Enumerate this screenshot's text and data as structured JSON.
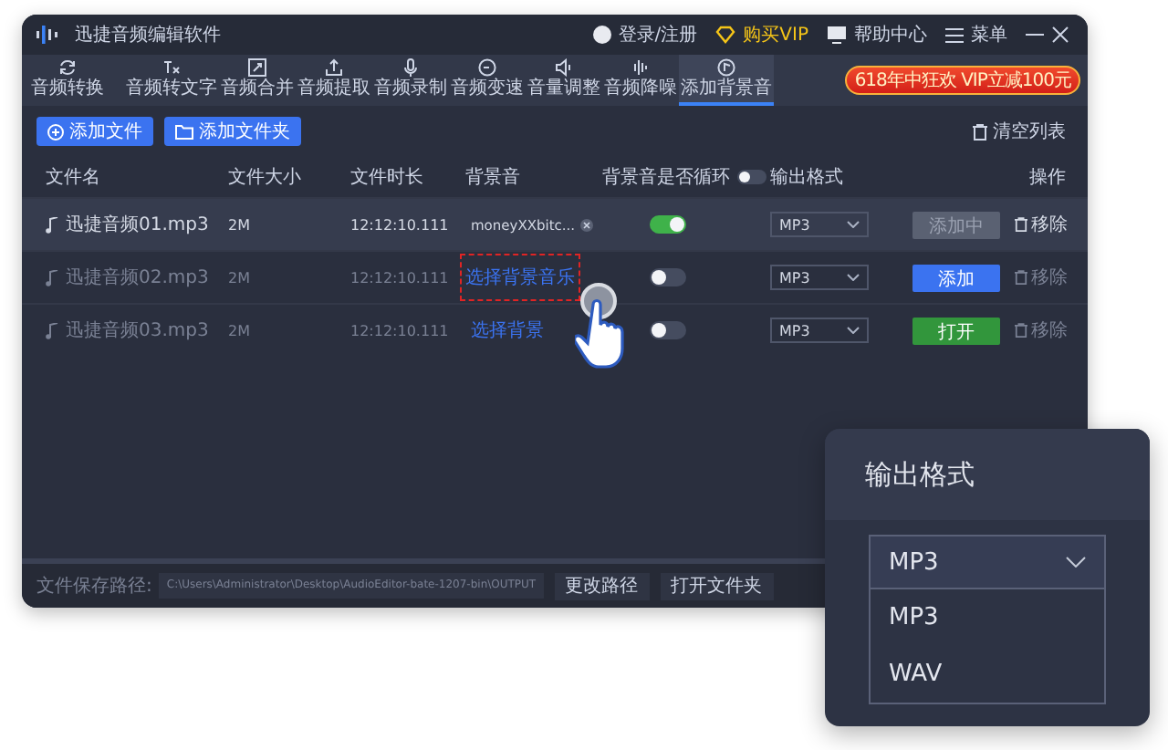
{
  "window": {
    "title": "迅捷音频编辑软件"
  },
  "title_bar": {
    "login": "登录/注册",
    "vip": "购买VIP",
    "help": "帮助中心",
    "menu": "菜单"
  },
  "tabs": [
    {
      "label": "音频转换",
      "selected": false
    },
    {
      "label": "音频转文字",
      "selected": false
    },
    {
      "label": "音频合并",
      "selected": false
    },
    {
      "label": "音频提取",
      "selected": false
    },
    {
      "label": "音频录制",
      "selected": false
    },
    {
      "label": "音频变速",
      "selected": false
    },
    {
      "label": "音量调整",
      "selected": false
    },
    {
      "label": "音频降噪",
      "selected": false
    },
    {
      "label": "添加背景音",
      "selected": true
    }
  ],
  "promo": "618年中狂欢 VIP立减100元",
  "actions": {
    "add_file": "添加文件",
    "add_folder": "添加文件夹",
    "clear_list": "清空列表"
  },
  "table": {
    "columns": [
      "文件名",
      "文件大小",
      "文件时长",
      "背景音",
      "背景音是否循环",
      "输出格式",
      "操作"
    ],
    "loop_header_on": false,
    "rows": [
      {
        "name": "迅捷音频01.mp3",
        "size": "2M",
        "duration": "12:12:10.111",
        "background": {
          "kind": "file",
          "text": "moneyXXbitc..."
        },
        "highlighted": false,
        "loop": true,
        "format": "MP3",
        "action": {
          "kind": "disabled",
          "label": "添加中"
        },
        "remove": "移除",
        "selected": true
      },
      {
        "name": "迅捷音频02.mp3",
        "size": "2M",
        "duration": "12:12:10.111",
        "background": {
          "kind": "link",
          "text": "选择背景音乐"
        },
        "highlighted": true,
        "loop": false,
        "format": "MP3",
        "action": {
          "kind": "primary",
          "label": "添加"
        },
        "remove": "移除",
        "selected": false
      },
      {
        "name": "迅捷音频03.mp3",
        "size": "2M",
        "duration": "12:12:10.111",
        "background": {
          "kind": "link",
          "text": "选择背景"
        },
        "highlighted": false,
        "loop": false,
        "format": "MP3",
        "action": {
          "kind": "success",
          "label": "打开"
        },
        "remove": "移除",
        "selected": false
      }
    ]
  },
  "footer": {
    "label": "文件保存路径:",
    "path": "C:\\Users\\Administrator\\Desktop\\AudioEditor-bate-1207-bin\\OUTPUT",
    "change": "更改路径",
    "open": "打开文件夹"
  },
  "format_popup": {
    "title": "输出格式",
    "value": "MP3",
    "expanded": true,
    "options": [
      "MP3",
      "WAV"
    ]
  }
}
